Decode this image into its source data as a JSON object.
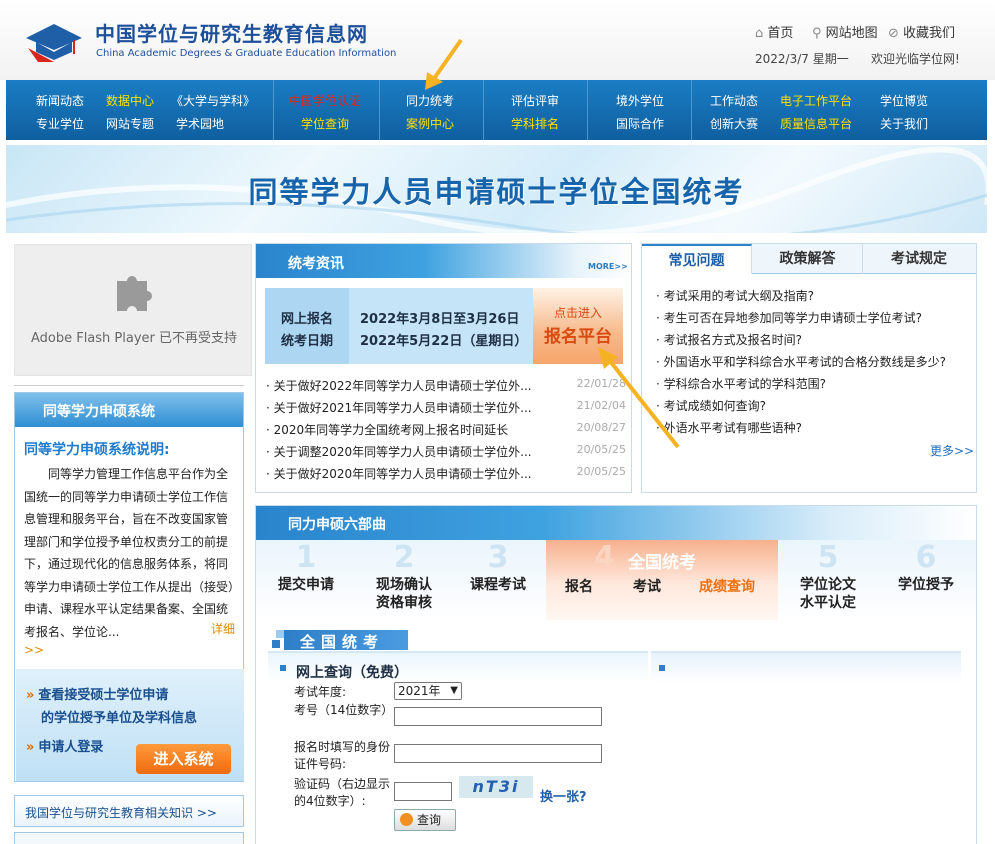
{
  "header": {
    "logo_cn": "中国学位与研究生教育信息网",
    "logo_en": "China Academic Degrees & Graduate Education Information",
    "links": [
      "首页",
      "网站地图",
      "收藏我们"
    ],
    "date": "2022/3/7 星期一",
    "welcome": "欢迎光临学位网!"
  },
  "nav": {
    "g1": [
      "新闻动态",
      "数据中心",
      "《大学与学科》",
      "专业学位",
      "网站专题",
      "学术园地"
    ],
    "g2": [
      "中国学位认证",
      "学位查询"
    ],
    "g3": [
      "同力统考",
      "案例中心"
    ],
    "g4": [
      "评估评审",
      "学科排名"
    ],
    "g5": [
      "境外学位",
      "国际合作"
    ],
    "g6": [
      "工作动态",
      "电子工作平台",
      "学位博览",
      "创新大赛",
      "质量信息平台",
      "关于我们"
    ]
  },
  "banner": {
    "title": "同等学力人员申请硕士学位全国统考"
  },
  "flash": {
    "text": "Adobe Flash Player 已不再受支持"
  },
  "left": {
    "head": "同等学力申硕系统",
    "subtitle": "同等学力申硕系统说明:",
    "desc": "同等学力管理工作信息平台作为全国统一的同等学力申请硕士学位工作信息管理和服务平台，旨在不改变国家管理部门和学位授予单位权责分工的前提下，通过现代化的信息服务体系，将同等学力申请硕士学位工作从提出（接受）申请、课程水平认定结果备案、全国统考报名、学位论...",
    "more": "详细",
    "more_arrow": ">>",
    "link1a": "查看接受硕士学位申请",
    "link1b": "的学位授予单位及学科信息",
    "link2": "申请人登录",
    "enter_btn": "进入系统",
    "knowledge": "我国学位与研究生教育相关知识  >>"
  },
  "news": {
    "head": "统考资讯",
    "more": "MORE>>",
    "reg_label1": "网上报名",
    "reg_label2": "统考日期",
    "reg_value1": "2022年3月8日至3月26日",
    "reg_value2": "2022年5月22日（星期日）",
    "btn_small": "点击进入",
    "btn_big": "报名平台",
    "items": [
      {
        "title": "· 关于做好2022年同等学力人员申请硕士学位外...",
        "date": "22/01/28"
      },
      {
        "title": "· 关于做好2021年同等学力人员申请硕士学位外...",
        "date": "21/02/04"
      },
      {
        "title": "· 2020年同等学力全国统考网上报名时间延长",
        "date": "20/08/27"
      },
      {
        "title": "· 关于调整2020年同等学力人员申请硕士学位外...",
        "date": "20/05/25"
      },
      {
        "title": "· 关于做好2020年同等学力人员申请硕士学位外...",
        "date": "20/05/25"
      }
    ]
  },
  "faq": {
    "tabs": [
      "常见问题",
      "政策解答",
      "考试规定"
    ],
    "items": [
      "· 考试采用的考试大纲及指南?",
      "· 考生可否在异地参加同等学力申请硕士学位考试?",
      "· 考试报名方式及报名时间?",
      "· 外国语水平和学科综合水平考试的合格分数线是多少?",
      "· 学科综合水平考试的学科范围?",
      "· 考试成绩如何查询?",
      "· 外语水平考试有哪些语种?"
    ],
    "more": "更多>>"
  },
  "steps": {
    "head": "同力申硕六部曲",
    "s1_num": "1",
    "s1": "提交申请",
    "s2_num": "2",
    "s2a": "现场确认",
    "s2b": "资格审核",
    "s3_num": "3",
    "s3": "课程考试",
    "s4_num": "4",
    "s4_title": "全国统考",
    "s4a": "报名",
    "s4b": "考试",
    "s4c": "成绩查询",
    "s5_num": "5",
    "s5a": "学位论文",
    "s5b": "水平认定",
    "s6_num": "6",
    "s6": "学位授予"
  },
  "query": {
    "section_title": "全国统考",
    "panel_title": "网上查询（免费）",
    "year_label": "考试年度:",
    "year_value": "2021年",
    "id_label": "考号（14位数字）:",
    "idcard_label": "报名时填写的身份证件号码:",
    "captcha_label": "验证码（右边显示的4位数字）:",
    "captcha_text": "nT3i",
    "refresh": "换一张?",
    "button": "查询"
  }
}
